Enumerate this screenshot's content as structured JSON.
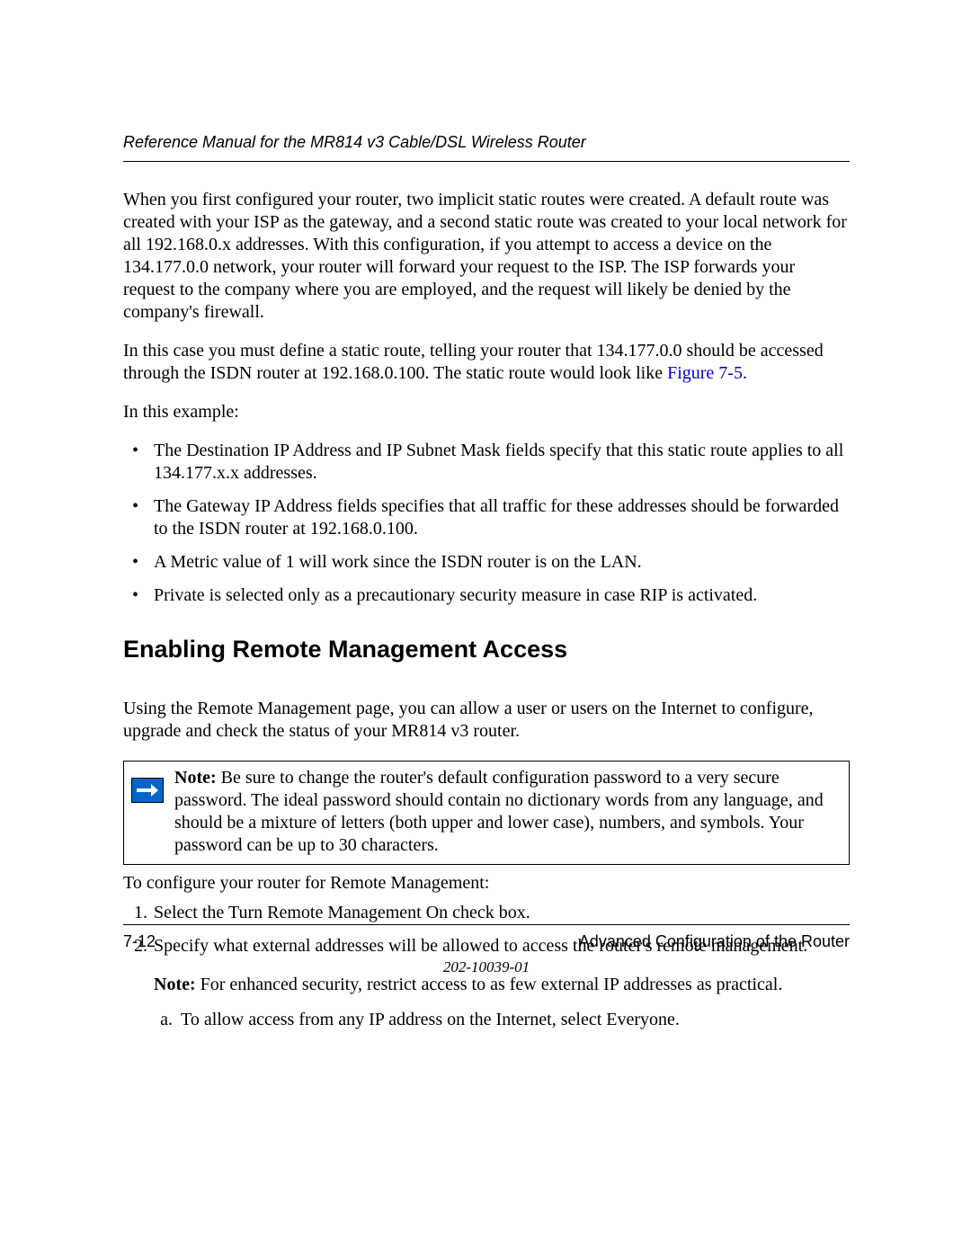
{
  "header": {
    "title": "Reference Manual for the MR814 v3 Cable/DSL Wireless Router"
  },
  "paragraphs": {
    "p1": "When you first configured your router, two implicit static routes were created. A default route was created with your ISP as the gateway, and a second static route was created to your local network for all 192.168.0.x addresses. With this configuration, if you attempt to access a device on the 134.177.0.0 network, your router will forward your request to the ISP. The ISP forwards your request to the company where you are employed, and the request will likely be denied by the company's firewall.",
    "p2_pre": "In this case you must define a static route, telling your router that 134.177.0.0 should be accessed through the ISDN router at 192.168.0.100. The static route would look like ",
    "p2_link": "Figure 7-5",
    "p2_post": ".",
    "p3": "In this example:",
    "intro_remote": "Using the Remote Management page, you can allow a user or users on the Internet to configure, upgrade and check the status of your MR814 v3 router.",
    "to_configure": "To configure your router for Remote Management:"
  },
  "bullets": [
    "The Destination IP Address and IP Subnet Mask fields specify that this static route applies to all 134.177.x.x addresses.",
    "The Gateway IP Address fields specifies that all traffic for these addresses should be forwarded to the ISDN router at 192.168.0.100.",
    "A Metric value of 1 will work since the ISDN router is on the LAN.",
    "Private is selected only as a precautionary security measure in case RIP is activated."
  ],
  "section_heading": "Enabling Remote Management Access",
  "note": {
    "label": "Note:",
    "text": " Be sure to change the router's default configuration password to a very secure password. The ideal password should contain no dictionary words from any language, and should be a mixture of letters (both upper and lower case), numbers, and symbols. Your password can be up to 30 characters."
  },
  "steps": [
    "Select the Turn Remote Management On check box.",
    "Specify what external addresses will be allowed to access the router's remote management."
  ],
  "step2_note_label": "Note:",
  "step2_note_text": " For enhanced security, restrict access to as few external IP addresses as practical.",
  "substeps": [
    "To allow access from any IP address on the Internet, select Everyone."
  ],
  "footer": {
    "page": "7-12",
    "chapter": "Advanced Configuration of the Router",
    "docnum": "202-10039-01"
  }
}
